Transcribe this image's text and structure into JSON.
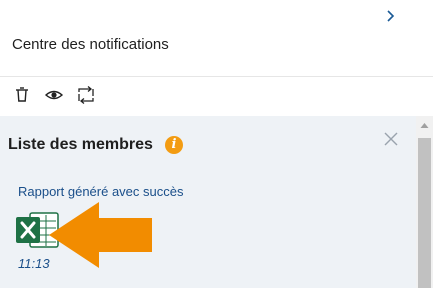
{
  "header": {
    "title": "Centre des notifications",
    "collapse_icon": "chevron-right-icon"
  },
  "toolbar": {
    "icons": [
      "trash-icon",
      "eye-icon",
      "swap-icon"
    ]
  },
  "card": {
    "title": "Liste des membres",
    "info_icon_glyph": "i",
    "message": "Rapport généré avec succès",
    "attachment_icon": "excel-file-icon",
    "time": "11:13"
  },
  "colors": {
    "accent_orange": "#f39c12",
    "link_blue": "#1a4f8a",
    "excel_green": "#1e7145",
    "content_bg": "#eef2f6"
  }
}
